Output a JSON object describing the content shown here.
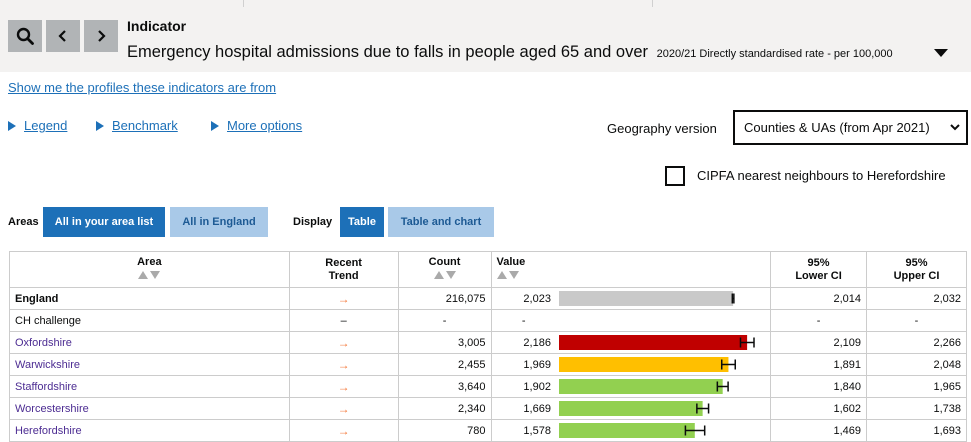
{
  "header": {
    "indicator_label": "Indicator",
    "indicator_title": "Emergency hospital admissions due to falls in people aged 65 and over",
    "indicator_meta": "2020/21 Directly standardised rate - per 100,000"
  },
  "profiles_link": "Show me the profiles these indicators are from",
  "options": {
    "legend": "Legend",
    "benchmark": "Benchmark",
    "more_options": "More options"
  },
  "geography": {
    "label": "Geography version",
    "selected": "Counties & UAs (from Apr 2021)"
  },
  "cipfa": {
    "label": "CIPFA nearest neighbours to Herefordshire",
    "checked": false
  },
  "areas_toggle": {
    "label": "Areas",
    "options": [
      "All in your area list",
      "All in England"
    ],
    "selected": "All in your area list"
  },
  "display_toggle": {
    "label": "Display",
    "options": [
      "Table",
      "Table and chart"
    ],
    "selected": "Table"
  },
  "table": {
    "headers": {
      "area": "Area",
      "trend_1": "Recent",
      "trend_2": "Trend",
      "count": "Count",
      "value": "Value",
      "lci_1": "95%",
      "lci_2": "Lower CI",
      "uci_1": "95%",
      "uci_2": "Upper CI"
    },
    "rows": [
      {
        "area": "England",
        "trend": "→",
        "count": "216,075",
        "value": "2,023",
        "lci": "2,014",
        "uci": "2,032"
      },
      {
        "area": "CH challenge",
        "trend": "–",
        "count": "-",
        "value": "-",
        "lci": "-",
        "uci": "-"
      },
      {
        "area": "Oxfordshire",
        "trend": "→",
        "count": "3,005",
        "value": "2,186",
        "lci": "2,109",
        "uci": "2,266"
      },
      {
        "area": "Warwickshire",
        "trend": "→",
        "count": "2,455",
        "value": "1,969",
        "lci": "1,891",
        "uci": "2,048"
      },
      {
        "area": "Staffordshire",
        "trend": "→",
        "count": "3,640",
        "value": "1,902",
        "lci": "1,840",
        "uci": "1,965"
      },
      {
        "area": "Worcestershire",
        "trend": "→",
        "count": "2,340",
        "value": "1,669",
        "lci": "1,602",
        "uci": "1,738"
      },
      {
        "area": "Herefordshire",
        "trend": "→",
        "count": "780",
        "value": "1,578",
        "lci": "1,469",
        "uci": "1,693"
      }
    ],
    "bars": [
      {
        "value": 2023,
        "lci": 2014,
        "uci": 2032,
        "color": "#c9c9c9"
      },
      null,
      {
        "value": 2186,
        "lci": 2109,
        "uci": 2266,
        "color": "#c00000"
      },
      {
        "value": 1969,
        "lci": 1891,
        "uci": 2048,
        "color": "#ffbf00"
      },
      {
        "value": 1902,
        "lci": 1840,
        "uci": 1965,
        "color": "#92d050"
      },
      {
        "value": 1669,
        "lci": 1602,
        "uci": 1738,
        "color": "#92d050"
      },
      {
        "value": 1578,
        "lci": 1469,
        "uci": 1693,
        "color": "#92d050"
      }
    ]
  },
  "colors": {
    "accent": "#1d70b8",
    "trend_arrow": "#f47738",
    "area_link": "#4c2c92"
  }
}
